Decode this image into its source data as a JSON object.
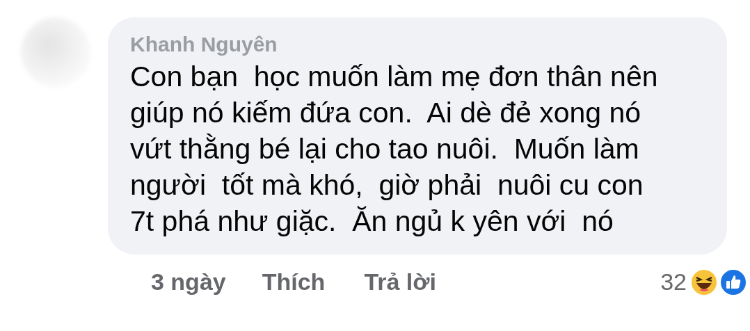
{
  "comment": {
    "author": "Khanh Nguyên",
    "text": "Con bạn  học muốn làm mẹ đơn thân nên\ngiúp nó kiếm đứa con.  Ai dè đẻ xong nó\nvứt thằng bé lại cho tao nuôi.  Muốn làm\nngười  tốt mà khó,  giờ phải  nuôi cu con\n7t phá như giặc.  Ăn ngủ k yên với  nó"
  },
  "actions": [
    {
      "kind": "time",
      "label": "3 ngày"
    },
    {
      "kind": "link",
      "label": "Thích"
    },
    {
      "kind": "link",
      "label": "Trả lời"
    }
  ],
  "reactions": {
    "count": "32",
    "icons": [
      {
        "kind": "haha"
      },
      {
        "kind": "like"
      }
    ]
  }
}
